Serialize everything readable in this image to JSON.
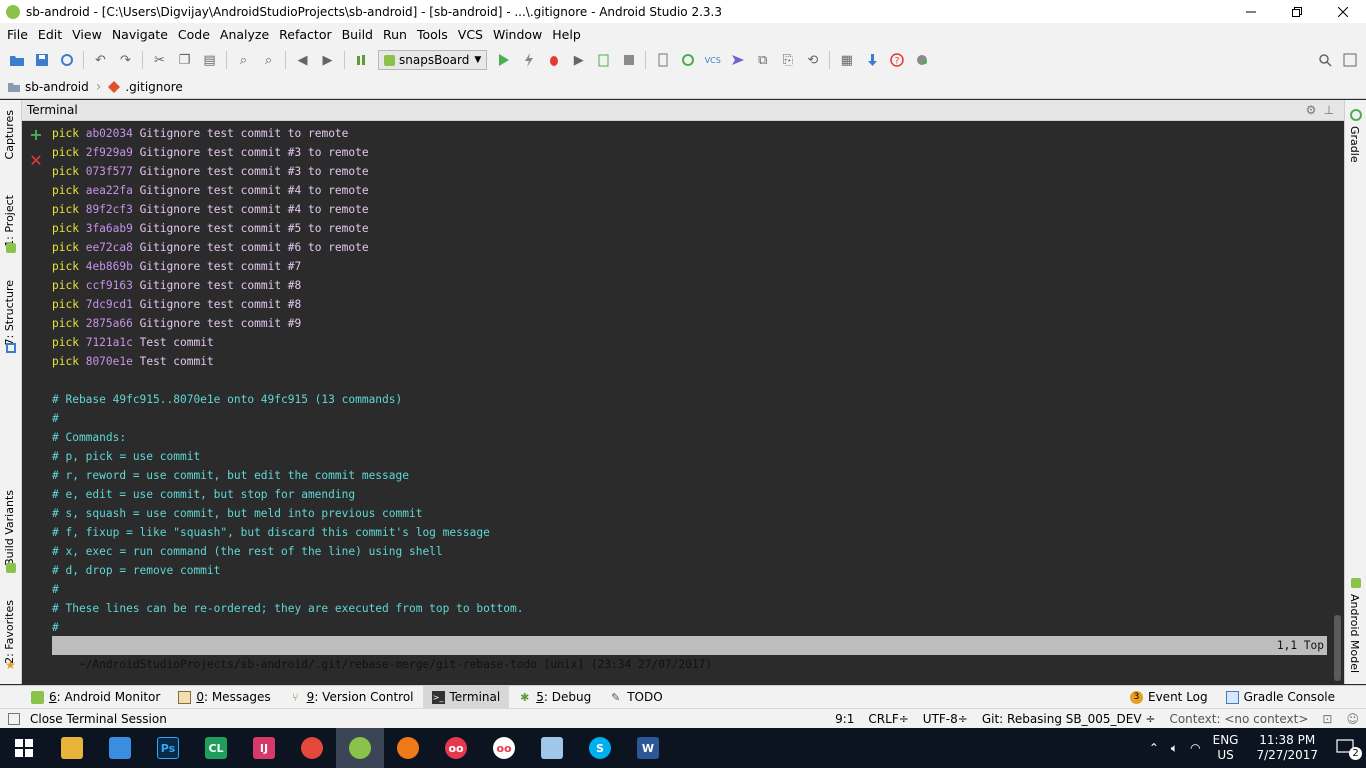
{
  "window": {
    "title": "sb-android - [C:\\Users\\Digvijay\\AndroidStudioProjects\\sb-android] - [sb-android] - ...\\.gitignore - Android Studio 2.3.3",
    "controls": [
      "—",
      "❐",
      "✕"
    ]
  },
  "menu": [
    "File",
    "Edit",
    "View",
    "Navigate",
    "Code",
    "Analyze",
    "Refactor",
    "Build",
    "Run",
    "Tools",
    "VCS",
    "Window",
    "Help"
  ],
  "toolbar": {
    "run_config": "snapsBoard"
  },
  "breadcrumb": {
    "project": "sb-android",
    "file": ".gitignore"
  },
  "left_tabs": {
    "captures": "Captures",
    "project": "1: Project",
    "structure": "7: Structure",
    "build_variants": "Build Variants",
    "favorites": "2: Favorites"
  },
  "right_tabs": {
    "gradle": "Gradle",
    "android_model": "Android Model"
  },
  "panel": {
    "title": "Terminal"
  },
  "terminal": {
    "pick_lines": [
      {
        "kw": "pick",
        "hash": "ab02034",
        "msg": "Gitignore test commit to remote"
      },
      {
        "kw": "pick",
        "hash": "2f929a9",
        "msg": "Gitignore test commit #3 to remote"
      },
      {
        "kw": "pick",
        "hash": "073f577",
        "msg": "Gitignore test commit #3 to remote"
      },
      {
        "kw": "pick",
        "hash": "aea22fa",
        "msg": "Gitignore test commit #4 to remote"
      },
      {
        "kw": "pick",
        "hash": "89f2cf3",
        "msg": "Gitignore test commit #4 to remote"
      },
      {
        "kw": "pick",
        "hash": "3fa6ab9",
        "msg": "Gitignore test commit #5 to remote"
      },
      {
        "kw": "pick",
        "hash": "ee72ca8",
        "msg": "Gitignore test commit #6 to remote"
      },
      {
        "kw": "pick",
        "hash": "4eb869b",
        "msg": "Gitignore test commit #7"
      },
      {
        "kw": "pick",
        "hash": "ccf9163",
        "msg": "Gitignore test commit #8"
      },
      {
        "kw": "pick",
        "hash": "7dc9cd1",
        "msg": "Gitignore test commit #8"
      },
      {
        "kw": "pick",
        "hash": "2875a66",
        "msg": "Gitignore test commit #9"
      },
      {
        "kw": "pick",
        "hash": "7121a1c",
        "msg": "Test commit"
      },
      {
        "kw": "pick",
        "hash": "8070e1e",
        "msg": "Test commit"
      }
    ],
    "comment_lines": [
      "# Rebase 49fc915..8070e1e onto 49fc915 (13 commands)",
      "#",
      "# Commands:",
      "# p, pick = use commit",
      "# r, reword = use commit, but edit the commit message",
      "# e, edit = use commit, but stop for amending",
      "# s, squash = use commit, but meld into previous commit",
      "# f, fixup = like \"squash\", but discard this commit's log message",
      "# x, exec = run command (the rest of the line) using shell",
      "# d, drop = remove commit",
      "#",
      "# These lines can be re-ordered; they are executed from top to bottom.",
      "#"
    ],
    "vim_status_left": "~/AndroidStudioProjects/sb-android/.git/rebase-merge/git-rebase-todo [unix] (23:34 27/07/2017)",
    "vim_status_right": "1,1 Top"
  },
  "bottom_tabs": [
    {
      "num": "6",
      "label": ": Android Monitor"
    },
    {
      "num": "0",
      "label": ": Messages"
    },
    {
      "num": "9",
      "label": ": Version Control"
    },
    {
      "num": "",
      "label": "Terminal"
    },
    {
      "num": "5",
      "label": ": Debug"
    },
    {
      "num": "",
      "label": "TODO"
    }
  ],
  "bottom_right_tabs": {
    "event_log": "Event Log",
    "event_log_badge": "3",
    "gradle_console": "Gradle Console"
  },
  "status": {
    "message": "Close Terminal Session",
    "position": "9:1",
    "line_sep": "CRLF÷",
    "encoding": "UTF-8÷",
    "git": "Git: Rebasing SB_005_DEV ÷",
    "context": "Context: <no context>"
  },
  "taskbar": {
    "lang_top": "ENG",
    "lang_bottom": "US",
    "time": "11:38 PM",
    "date": "7/27/2017",
    "notif_count": "2"
  },
  "colors": {
    "terminal_bg": "#2b2b2b",
    "keyword": "#e6e63a",
    "hash": "#c792ea",
    "comment": "#5fd7d7"
  }
}
